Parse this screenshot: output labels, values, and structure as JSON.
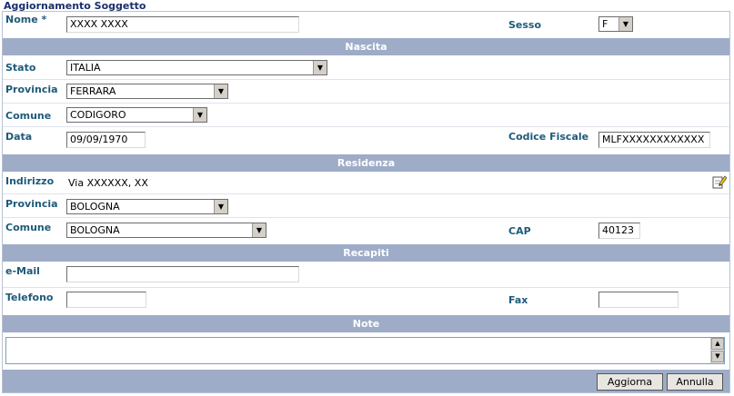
{
  "title": "Aggiornamento Soggetto",
  "fields": {
    "nome_label": "Nome *",
    "nome_value": "XXXX       XXXX",
    "sesso_label": "Sesso",
    "sesso_value": "F",
    "stato_label": "Stato",
    "stato_value": "ITALIA",
    "provincia_nascita_label": "Provincia",
    "provincia_nascita_value": "FERRARA",
    "comune_nascita_label": "Comune",
    "comune_nascita_value": "CODIGORO",
    "data_label": "Data",
    "data_value": "09/09/1970",
    "cf_label": "Codice Fiscale",
    "cf_value": "MLFXXXXXXXXXXXX",
    "indirizzo_label": "Indirizzo",
    "indirizzo_value": "Via XXXXXX, XX",
    "provincia_res_label": "Provincia",
    "provincia_res_value": "BOLOGNA",
    "comune_res_label": "Comune",
    "comune_res_value": "BOLOGNA",
    "cap_label": "CAP",
    "cap_value": "40123",
    "email_label": "e-Mail",
    "email_value": "",
    "telefono_label": "Telefono",
    "telefono_value": "",
    "fax_label": "Fax",
    "fax_value": "",
    "note_value": ""
  },
  "sections": {
    "nascita": "Nascita",
    "residenza": "Residenza",
    "recapiti": "Recapiti",
    "note": "Note"
  },
  "buttons": {
    "aggiorna": "Aggiorna",
    "annulla": "Annulla"
  },
  "colors": {
    "section_bg": "#9eacc7",
    "label": "#1e5a7a",
    "title": "#1a2f6b"
  }
}
